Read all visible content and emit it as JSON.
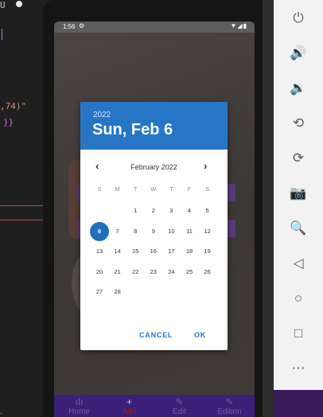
{
  "editor": {
    "line1": "U",
    "line2": ",74)\"",
    "line3": "}}",
    "bottom_text": "."
  },
  "status_bar": {
    "time": "1:56",
    "icons": "▼◢▮"
  },
  "date_picker": {
    "year": "2022",
    "selected_date": "Sun, Feb 6",
    "month_label": "February 2022",
    "weekdays": [
      "S",
      "M",
      "T",
      "W",
      "T",
      "F",
      "S"
    ],
    "days": [
      "1",
      "2",
      "3",
      "4",
      "5",
      "6",
      "7",
      "8",
      "9",
      "10",
      "11",
      "12",
      "13",
      "14",
      "15",
      "16",
      "17",
      "18",
      "19",
      "20",
      "21",
      "22",
      "23",
      "24",
      "25",
      "26",
      "27",
      "28"
    ],
    "first_weekday_index": 2,
    "selected_day": "6",
    "cancel_label": "CANCEL",
    "ok_label": "OK",
    "accent_color": "#2776c6"
  },
  "bottom_nav": {
    "items": [
      {
        "label": "Home",
        "icon": "bar-chart-icon"
      },
      {
        "label": "Add",
        "icon": "plus-icon"
      },
      {
        "label": "Edit",
        "icon": "pencil-icon"
      },
      {
        "label": "Edition",
        "icon": "pencil-icon"
      }
    ]
  },
  "emulator_toolbar": {
    "buttons": [
      {
        "name": "power-icon",
        "glyph": "⏻"
      },
      {
        "name": "volume-up-icon",
        "glyph": "🔊"
      },
      {
        "name": "volume-down-icon",
        "glyph": "🔉"
      },
      {
        "name": "rotate-left-icon",
        "glyph": "⟲"
      },
      {
        "name": "rotate-right-icon",
        "glyph": "⟳"
      },
      {
        "name": "camera-icon",
        "glyph": "📷"
      },
      {
        "name": "zoom-icon",
        "glyph": "🔍"
      },
      {
        "name": "back-icon",
        "glyph": "◁"
      },
      {
        "name": "home-icon",
        "glyph": "○"
      },
      {
        "name": "overview-icon",
        "glyph": "□"
      },
      {
        "name": "more-icon",
        "glyph": "⋯"
      }
    ]
  }
}
